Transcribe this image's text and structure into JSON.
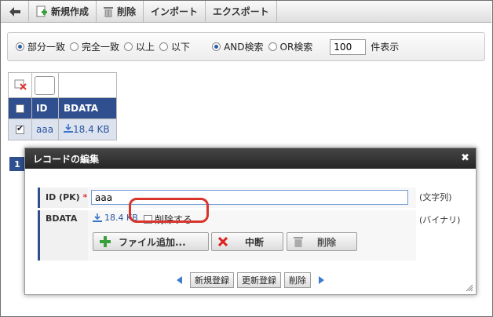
{
  "toolbar": {
    "back_label": "",
    "new_label": "新規作成",
    "delete_label": "削除",
    "import_label": "インポート",
    "export_label": "エクスポート"
  },
  "search": {
    "options": [
      "部分一致",
      "完全一致",
      "以上",
      "以下"
    ],
    "selected_option": "部分一致",
    "logic_options": [
      "AND検索",
      "OR検索"
    ],
    "selected_logic": "AND検索",
    "count_value": "100",
    "count_suffix": "件表示"
  },
  "table": {
    "headers": [
      "ID",
      "BDATA"
    ],
    "rows": [
      {
        "checked": true,
        "id": "aaa",
        "bdata": "18.4 KB"
      }
    ]
  },
  "pagination": {
    "current_page": "1"
  },
  "dialog": {
    "title": "レコードの編集",
    "fields": [
      {
        "label": "ID (PK)",
        "required_mark": "*",
        "value": "aaa",
        "type": "(文字列)"
      },
      {
        "label": "BDATA",
        "file_size": "18.4 KB",
        "delete_checkbox_label": "削除する",
        "type": "(バイナリ)"
      }
    ],
    "buttons": {
      "add_file": "ファイル追加...",
      "cancel": "中断",
      "delete": "削除"
    },
    "nav": {
      "new_register": "新規登録",
      "update_register": "更新登録",
      "delete": "削除"
    }
  },
  "colors": {
    "header_blue": "#2f4f8f",
    "highlight_red": "#d9342b",
    "link_blue": "#2a55a0"
  }
}
